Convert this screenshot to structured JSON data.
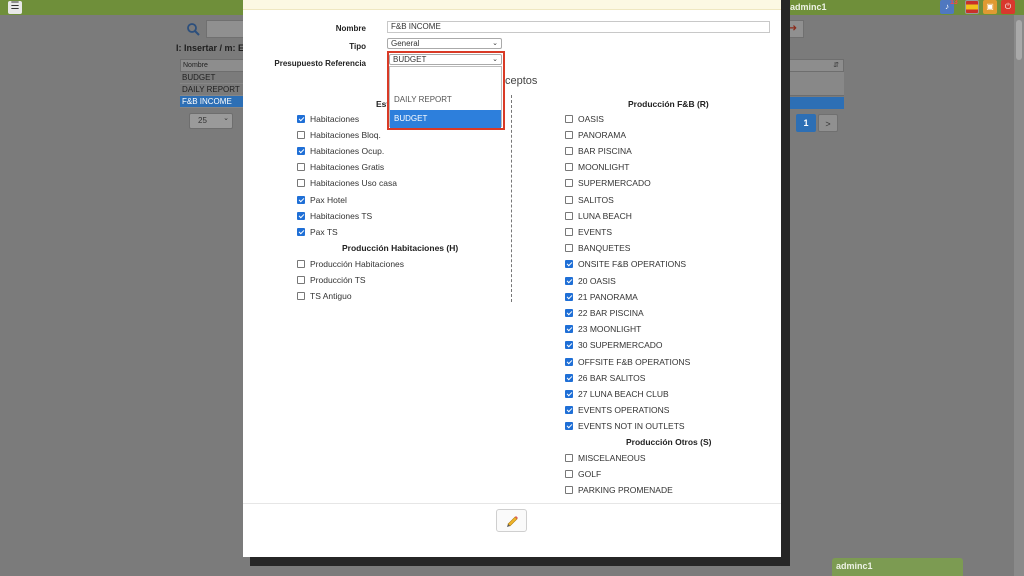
{
  "app": {
    "user": "adminc1",
    "notif_count": "13",
    "menu_glyph": "☰",
    "hint": "I: Insertar / m: Ed",
    "grid_header": "Nombre",
    "rows": [
      "BUDGET",
      "DAILY REPORT",
      "F&B INCOME"
    ],
    "page_size": "25",
    "page_current": "1",
    "page_next": ">",
    "bottom_user": "adminc1"
  },
  "form": {
    "nombre_label": "Nombre",
    "nombre_value": "F&B INCOME",
    "tipo_label": "Tipo",
    "tipo_value": "General",
    "presupuesto_label": "Presupuesto Referencia",
    "presupuesto_value": "BUDGET",
    "dropdown_options": [
      "",
      "DAILY REPORT",
      "BUDGET"
    ],
    "concepts_title": "ceptos"
  },
  "left": {
    "sec1_title": "Est",
    "sec1_items": [
      {
        "label": "Habitaciones",
        "checked": true
      },
      {
        "label": "Habitaciones Bloq.",
        "checked": false
      },
      {
        "label": "Habitaciones Ocup.",
        "checked": true
      },
      {
        "label": "Habitaciones Gratis",
        "checked": false
      },
      {
        "label": "Habitaciones Uso casa",
        "checked": false
      },
      {
        "label": "Pax Hotel",
        "checked": true
      },
      {
        "label": "Habitaciones TS",
        "checked": true
      },
      {
        "label": "Pax TS",
        "checked": true
      }
    ],
    "sec2_title": "Producción Habitaciones (H)",
    "sec2_items": [
      {
        "label": "Producción Habitaciones",
        "checked": false
      },
      {
        "label": "Producción TS",
        "checked": false
      },
      {
        "label": "TS Antiguo",
        "checked": false
      }
    ]
  },
  "right": {
    "sec1_title": "Producción F&B (R)",
    "sec1_items": [
      {
        "label": "OASIS",
        "checked": false
      },
      {
        "label": "PANORAMA",
        "checked": false
      },
      {
        "label": "BAR PISCINA",
        "checked": false
      },
      {
        "label": "MOONLIGHT",
        "checked": false
      },
      {
        "label": "SUPERMERCADO",
        "checked": false
      },
      {
        "label": "SALITOS",
        "checked": false
      },
      {
        "label": "LUNA BEACH",
        "checked": false
      },
      {
        "label": "EVENTS",
        "checked": false
      },
      {
        "label": "BANQUETES",
        "checked": false
      },
      {
        "label": "ONSITE F&B OPERATIONS",
        "checked": true
      },
      {
        "label": "20 OASIS",
        "checked": true
      },
      {
        "label": "21 PANORAMA",
        "checked": true
      },
      {
        "label": "22 BAR PISCINA",
        "checked": true
      },
      {
        "label": "23 MOONLIGHT",
        "checked": true
      },
      {
        "label": "30 SUPERMERCADO",
        "checked": true
      },
      {
        "label": "OFFSITE F&B OPERATIONS",
        "checked": true
      },
      {
        "label": "26 BAR SALITOS",
        "checked": true
      },
      {
        "label": "27 LUNA BEACH CLUB",
        "checked": true
      },
      {
        "label": "EVENTS OPERATIONS",
        "checked": true
      },
      {
        "label": "EVENTS NOT IN OUTLETS",
        "checked": true
      }
    ],
    "sec2_title": "Producción Otros (S)",
    "sec2_items": [
      {
        "label": "MISCELANEOUS",
        "checked": false
      },
      {
        "label": "GOLF",
        "checked": false
      },
      {
        "label": "PARKING PROMENADE",
        "checked": false
      }
    ]
  }
}
